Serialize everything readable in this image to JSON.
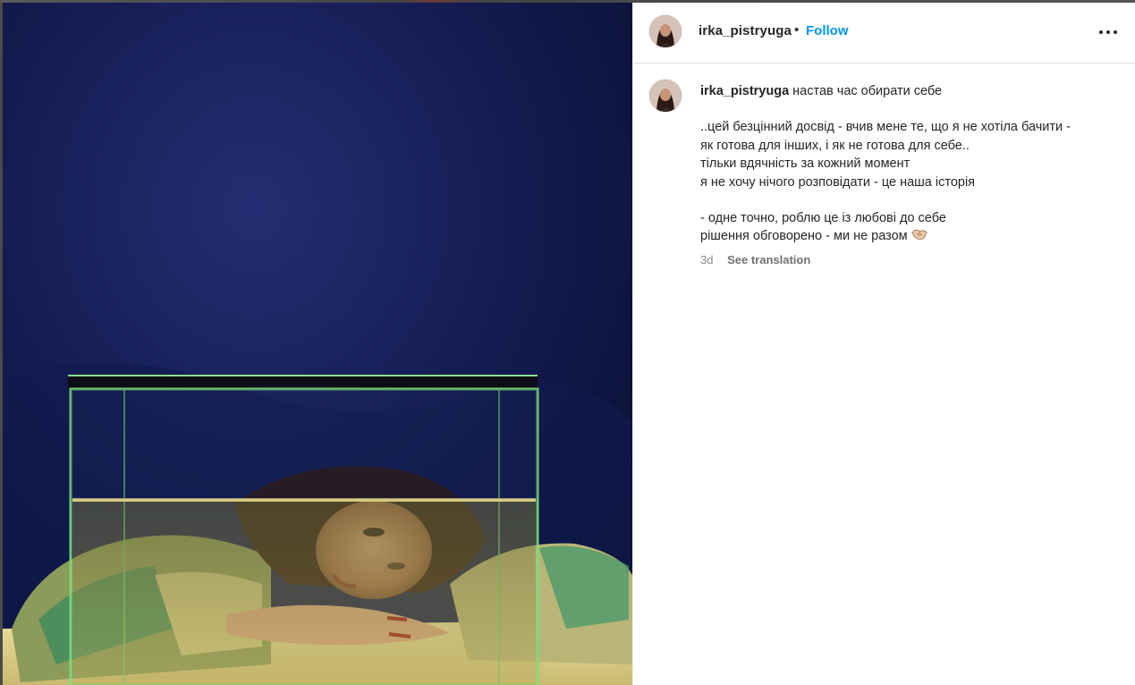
{
  "post": {
    "author": {
      "username": "irka_pistryuga",
      "separator": "•",
      "follow_label": "Follow"
    },
    "header_icons": {
      "avatar": "profile-avatar",
      "more": "more-options-icon"
    },
    "photo": {
      "description_icon": "post-photo"
    },
    "caption": {
      "username": "irka_pistryuga",
      "title": "настав час обирати себе",
      "lines": [
        "..цей безцінний досвід - вчив мене те, що я не хотіла бачити -",
        "як готова для інших, і як не готова для себе..",
        "тільки вдячність за кожний момент",
        "я не хочу нічого розповідати - це наша історія",
        "- одне точно, роблю це із любові до себе",
        "рішення обговорено - ми не разом"
      ],
      "emoji": "handshake-emoji",
      "time_ago": "3d",
      "see_translation": "See translation"
    },
    "colors": {
      "link": "#0095f6",
      "text": "#262626",
      "muted": "#8e8e8e",
      "divider": "#dbdbdb"
    }
  }
}
